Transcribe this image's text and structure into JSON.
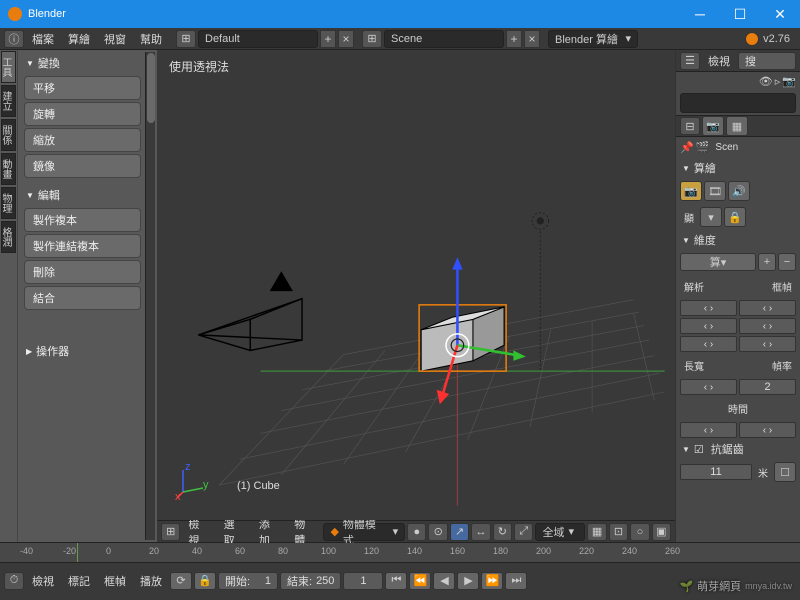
{
  "window": {
    "title": "Blender"
  },
  "version": "v2.76",
  "topmenu": {
    "file": "檔案",
    "render": "算繪",
    "window": "視窗",
    "help": "幫助"
  },
  "layout_dropdown": "Default",
  "scene_dropdown": "Scene",
  "engine_dropdown": "Blender 算繪",
  "left": {
    "tabs": [
      "工具",
      "建立",
      "關係",
      "動畫",
      "物理",
      "格潤"
    ],
    "transform_header": "變換",
    "translate": "平移",
    "rotate": "旋轉",
    "scale": "縮放",
    "mirror": "鏡像",
    "edit_header": "編輯",
    "duplicate": "製作複本",
    "duplicate_linked": "製作連結複本",
    "delete": "刪除",
    "join": "結合",
    "operator_header": "操作器"
  },
  "viewport": {
    "persp_label": "使用透視法",
    "object_info": "(1) Cube"
  },
  "viewport_menu": {
    "view": "檢視",
    "select": "選取",
    "add": "添加",
    "object": "物體"
  },
  "mode_label": "物體模式",
  "overlay_label": "全域",
  "right": {
    "view_menu": "檢視",
    "search_placeholder": "搜",
    "scene_label": "Scen",
    "render_header": "算繪",
    "display_label": "顯",
    "dimensions_header": "維度",
    "calc_label": "算",
    "resolution_label": "解析",
    "frame_label": "框幀",
    "aspect_label": "長寬",
    "fps_label": "幀率",
    "fps_value": "2",
    "time_label": "時間",
    "aa_header": "抗鋸齒",
    "aa_value": "11",
    "mi_label": "米"
  },
  "timeline": {
    "ticks": [
      -40,
      -20,
      0,
      20,
      40,
      60,
      80,
      100,
      120,
      140,
      160,
      180,
      200,
      220,
      240,
      260
    ],
    "view": "檢視",
    "marker": "標記",
    "frame": "框幀",
    "playback": "播放",
    "start_label": "開始:",
    "start_value": "1",
    "end_label": "結束:",
    "end_value": "250",
    "current": "1"
  },
  "watermark": "萌芽網頁"
}
